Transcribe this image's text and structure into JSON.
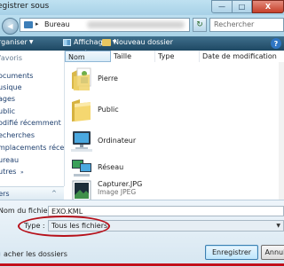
{
  "window": {
    "title": "egistrer sous",
    "minimize_glyph": "—",
    "maximize_glyph": "□",
    "close_glyph": "X"
  },
  "address": {
    "location": "Bureau",
    "chevron": "▸",
    "dropdown_glyph": "▼",
    "refresh_glyph": "↻",
    "search_placeholder": "Rechercher"
  },
  "toolbar": {
    "organiser": "rganiser",
    "affichages": "Affichages",
    "nouveau_dossier": "Nouveau dossier",
    "dropdown_glyph": "▼",
    "help_glyph": "?"
  },
  "nav": {
    "items": [
      {
        "label": "favoris",
        "favorite": true
      },
      {
        "label": "ocuments",
        "favorite": false
      },
      {
        "label": "usique",
        "favorite": false
      },
      {
        "label": "ages",
        "favorite": false
      },
      {
        "label": "ublic",
        "favorite": false
      },
      {
        "label": "odifié récemment",
        "favorite": false
      },
      {
        "label": "echerches",
        "favorite": false
      },
      {
        "label": "mplacements réce...",
        "favorite": false
      },
      {
        "label": "ureau",
        "favorite": false
      },
      {
        "label": "utres",
        "favorite": false,
        "arrow": "»"
      }
    ],
    "dossiers_label": "iers",
    "dossiers_arrow": "^"
  },
  "file_list": {
    "columns": [
      "Nom",
      "Taille",
      "Type",
      "Date de modification"
    ],
    "sort_arrow": "^",
    "items": [
      {
        "name": "Pierre",
        "subtitle": "",
        "icon": "user-folder-icon"
      },
      {
        "name": "Public",
        "subtitle": "",
        "icon": "folder-icon"
      },
      {
        "name": "Ordinateur",
        "subtitle": "",
        "icon": "computer-icon"
      },
      {
        "name": "Réseau",
        "subtitle": "",
        "icon": "network-icon"
      },
      {
        "name": "Capturer.JPG",
        "subtitle": "Image JPEG",
        "icon": "image-file-icon"
      }
    ]
  },
  "form": {
    "filename_label": "Nom du fichier :",
    "filename_value": "EXO.KML",
    "type_label": "Type :",
    "type_value": "Tous les fichiers",
    "type_dropdown_glyph": "▼",
    "hide_folders_label": "acher les dossiers",
    "save_label": "Enregistrer",
    "cancel_label": "Annuler"
  },
  "colors": {
    "toolbar": "#1e4863",
    "annotation": "#b6101a",
    "titlebar": "#a7d1e7"
  }
}
